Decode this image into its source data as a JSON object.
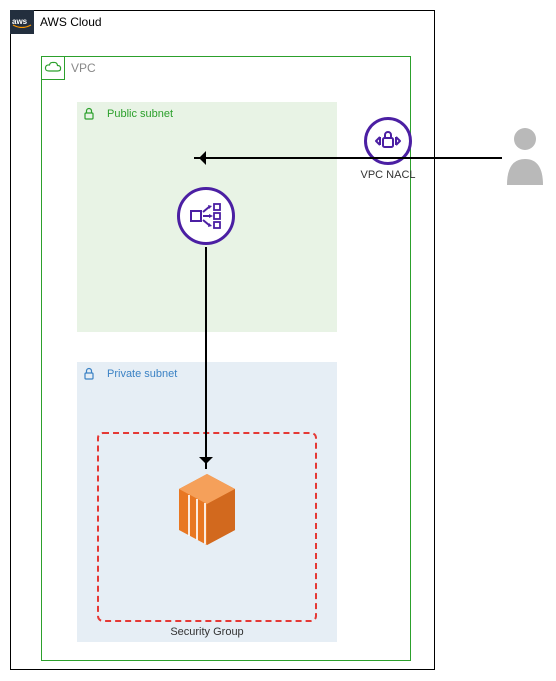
{
  "aws_cloud": {
    "label": "AWS Cloud"
  },
  "vpc": {
    "label": "VPC"
  },
  "public_subnet": {
    "label": "Public subnet"
  },
  "private_subnet": {
    "label": "Private subnet"
  },
  "security_group": {
    "label": "Security Group"
  },
  "nacl": {
    "label": "VPC NACL"
  },
  "colors": {
    "vpc_border": "#2ca02c",
    "private_blue": "#3b82c4",
    "purple": "#4b1fa3",
    "sg_red": "#e53935",
    "ec2_orange": "#e87722"
  }
}
